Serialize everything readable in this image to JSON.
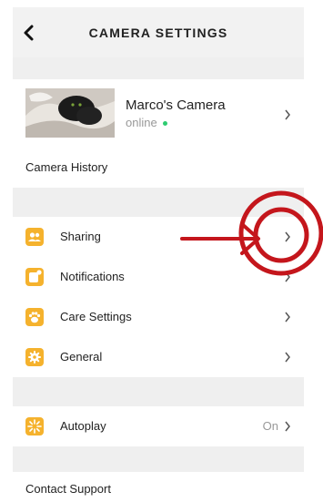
{
  "header": {
    "title": "CAMERA SETTINGS"
  },
  "camera": {
    "name": "Marco's Camera",
    "status": "online"
  },
  "camera_history": "Camera History",
  "menu": [
    {
      "label": "Sharing",
      "icon": "people-icon"
    },
    {
      "label": "Notifications",
      "icon": "notification-icon"
    },
    {
      "label": "Care Settings",
      "icon": "paw-icon"
    },
    {
      "label": "General",
      "icon": "gear-icon"
    }
  ],
  "autoplay": {
    "label": "Autoplay",
    "icon": "sparkle-icon",
    "value": "On"
  },
  "contact_support": "Contact Support",
  "colors": {
    "accent": "#f5b22d",
    "online": "#2ecc71",
    "annotation": "#c4161c"
  }
}
